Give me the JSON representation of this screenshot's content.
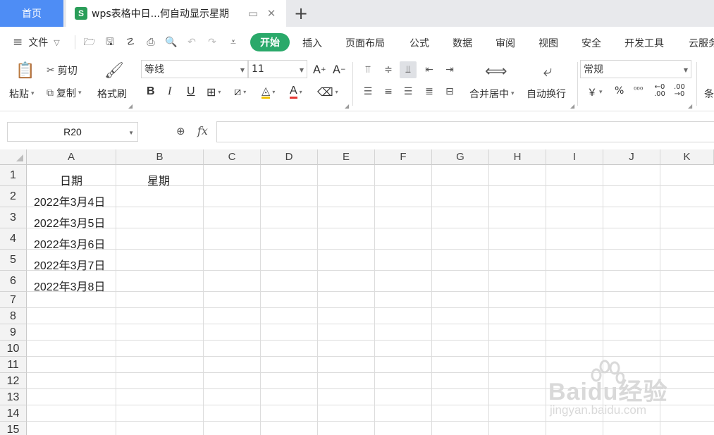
{
  "tabs": {
    "home": "首页",
    "doc_icon": "S",
    "doc_title": "wps表格中日...何自动显示星期",
    "add": "+"
  },
  "menubar": {
    "file": "文件",
    "start": "开始",
    "items": [
      "插入",
      "页面布局",
      "公式",
      "数据",
      "审阅",
      "视图",
      "安全",
      "开发工具",
      "云服务"
    ]
  },
  "ribbon": {
    "paste": "粘贴",
    "cut": "剪切",
    "copy": "复制",
    "format_painter": "格式刷",
    "font_name": "等线",
    "font_size": "11",
    "bold": "B",
    "italic": "I",
    "underline": "U",
    "merge_center": "合并居中",
    "wrap_text": "自动换行",
    "number_format": "常规",
    "currency": "￥",
    "percent": "%",
    "conditional": "条"
  },
  "formula_bar": {
    "name_box": "R20",
    "fx": "fx",
    "formula": ""
  },
  "grid": {
    "columns": [
      "A",
      "B",
      "C",
      "D",
      "E",
      "F",
      "G",
      "H",
      "I",
      "J",
      "K"
    ],
    "rows": [
      "1",
      "2",
      "3",
      "4",
      "5",
      "6",
      "7",
      "8",
      "9",
      "10",
      "11",
      "12",
      "13",
      "14",
      "15"
    ],
    "cells": {
      "A1": "日期",
      "B1": "星期",
      "A2": "2022年3月4日",
      "A3": "2022年3月5日",
      "A4": "2022年3月6日",
      "A5": "2022年3月7日",
      "A6": "2022年3月8日"
    }
  },
  "watermark": {
    "main": "Baidu经验",
    "sub": "jingyan.baidu.com"
  },
  "colors": {
    "home_tab": "#4e8df5",
    "start_tab": "#2aa96a",
    "doc_icon": "#2a9d59"
  }
}
